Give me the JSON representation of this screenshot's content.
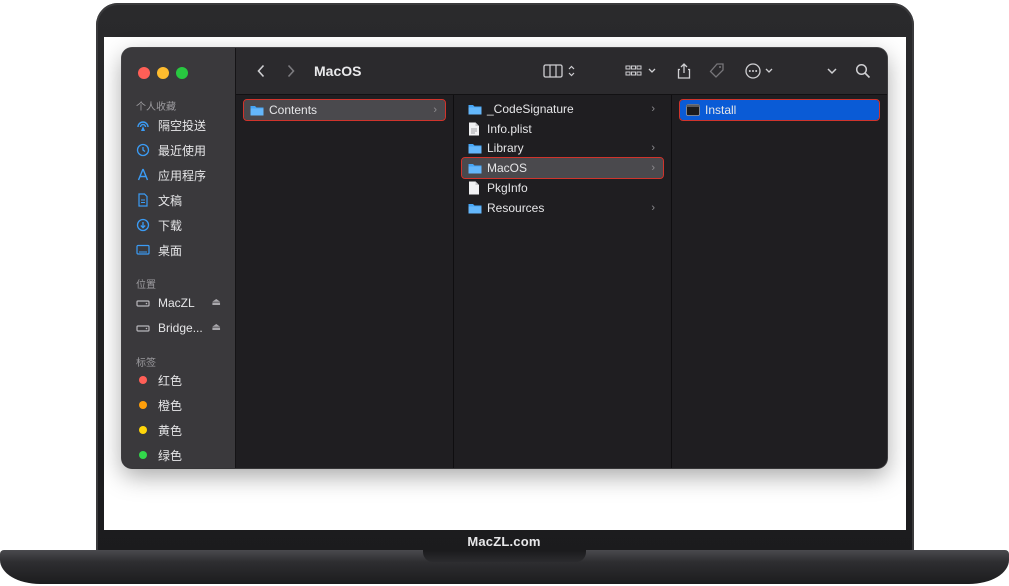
{
  "window": {
    "title": "MacOS"
  },
  "brand": "MacZL.com",
  "sidebar": {
    "favorites_header": "个人收藏",
    "favorites": [
      {
        "label": "隔空投送",
        "icon": "airdrop-icon"
      },
      {
        "label": "最近使用",
        "icon": "clock-icon"
      },
      {
        "label": "应用程序",
        "icon": "applications-icon"
      },
      {
        "label": "文稿",
        "icon": "document-icon"
      },
      {
        "label": "下载",
        "icon": "download-icon"
      },
      {
        "label": "桌面",
        "icon": "desktop-icon"
      }
    ],
    "locations_header": "位置",
    "locations": [
      {
        "label": "MacZL",
        "icon": "disk-icon"
      },
      {
        "label": "Bridge...",
        "icon": "disk-icon"
      }
    ],
    "tags_header": "标签",
    "tags": [
      {
        "label": "红色",
        "color": "#ff5f57"
      },
      {
        "label": "橙色",
        "color": "#ff9f0a"
      },
      {
        "label": "黄色",
        "color": "#ffd60a"
      },
      {
        "label": "绿色",
        "color": "#32d74b"
      }
    ]
  },
  "columns": {
    "col1": [
      {
        "label": "Contents",
        "type": "folder"
      }
    ],
    "col2": [
      {
        "label": "_CodeSignature",
        "type": "folder"
      },
      {
        "label": "Info.plist",
        "type": "file"
      },
      {
        "label": "Library",
        "type": "folder"
      },
      {
        "label": "MacOS",
        "type": "folder"
      },
      {
        "label": "PkgInfo",
        "type": "file"
      },
      {
        "label": "Resources",
        "type": "folder"
      }
    ],
    "col3": [
      {
        "label": "Install",
        "type": "executable"
      }
    ]
  },
  "colors": {
    "selection_blue": "#0a5bd6",
    "folder_blue": "#46a5f5",
    "highlight_red": "#d0342c"
  }
}
